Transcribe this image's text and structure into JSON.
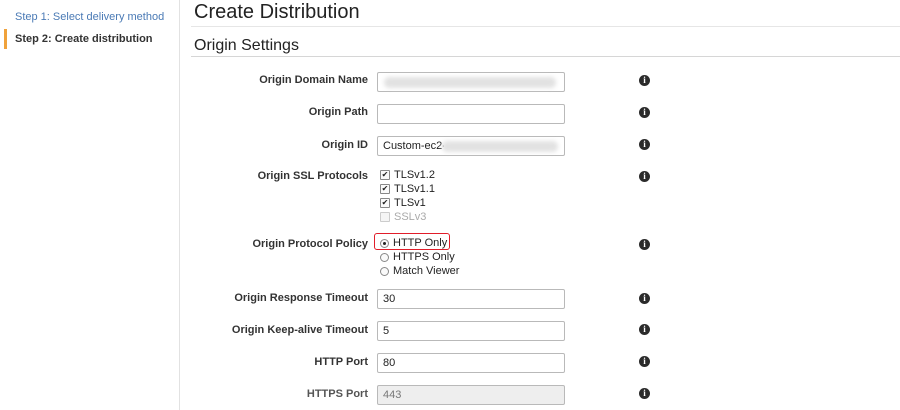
{
  "sidebar": {
    "steps": [
      {
        "label": "Step 1: Select delivery method"
      },
      {
        "label": "Step 2: Create distribution"
      }
    ]
  },
  "page": {
    "title": "Create Distribution",
    "section_title": "Origin Settings"
  },
  "form": {
    "origin_domain_name": {
      "label": "Origin Domain Name",
      "value": ""
    },
    "origin_path": {
      "label": "Origin Path",
      "value": ""
    },
    "origin_id": {
      "label": "Origin ID",
      "value": "Custom-ec2-"
    },
    "ssl_protocols": {
      "label": "Origin SSL Protocols",
      "options": [
        {
          "label": "TLSv1.2",
          "checked": true,
          "enabled": true
        },
        {
          "label": "TLSv1.1",
          "checked": true,
          "enabled": true
        },
        {
          "label": "TLSv1",
          "checked": true,
          "enabled": true
        },
        {
          "label": "SSLv3",
          "checked": false,
          "enabled": false
        }
      ]
    },
    "protocol_policy": {
      "label": "Origin Protocol Policy",
      "options": [
        {
          "label": "HTTP Only",
          "selected": true
        },
        {
          "label": "HTTPS Only",
          "selected": false
        },
        {
          "label": "Match Viewer",
          "selected": false
        }
      ],
      "highlight_color": "#e11d2a"
    },
    "response_timeout": {
      "label": "Origin Response Timeout",
      "value": "30"
    },
    "keepalive_timeout": {
      "label": "Origin Keep-alive Timeout",
      "value": "5"
    },
    "http_port": {
      "label": "HTTP Port",
      "value": "80"
    },
    "https_port": {
      "label": "HTTPS Port",
      "value": "443"
    }
  },
  "icons": {
    "info": "info-icon",
    "info_glyph": "i"
  },
  "colors": {
    "accent": "#f0a23b",
    "link": "#4a7ab5"
  }
}
